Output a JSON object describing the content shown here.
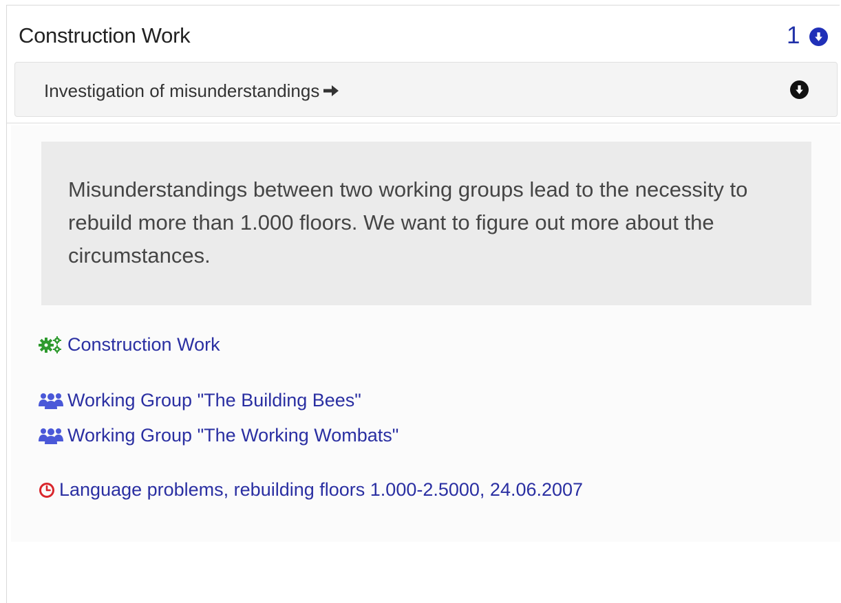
{
  "panel": {
    "title": "Construction Work",
    "count": "1",
    "count_icon": "circle-arrow-down-icon"
  },
  "subitem": {
    "label": "Investigation of misunderstandings",
    "arrow_icon": "arrow-right-icon",
    "toggle_icon": "circle-arrow-down-icon"
  },
  "detail": {
    "description": "Misunderstandings between two working groups lead to the necessity to rebuild more than 1.000 floors. We want to figure out more about the circumstances.",
    "project": {
      "icon": "cogs-icon",
      "label": "Construction Work",
      "icon_color": "#2e9a2e"
    },
    "groups": [
      {
        "icon": "group-icon",
        "label": "Working Group \"The Building Bees\""
      },
      {
        "icon": "group-icon",
        "label": "Working Group \"The Working Wombats\""
      }
    ],
    "event": {
      "icon": "clock-icon",
      "label": "Language problems, rebuilding floors 1.000-2.5000, 24.06.2007",
      "icon_color": "#d9262c"
    }
  },
  "colors": {
    "link": "#2a2fa2",
    "accent_blue": "#2030b8",
    "group_icon": "#4a58d8"
  }
}
